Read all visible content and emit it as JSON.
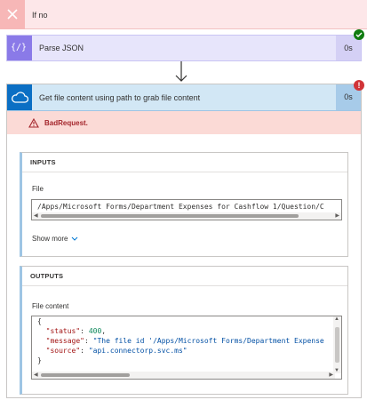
{
  "if_no": {
    "label": "If no"
  },
  "parse_json": {
    "title": "Parse JSON",
    "duration": "0s"
  },
  "get_file": {
    "title": "Get file content using path to grab file content",
    "duration": "0s",
    "error_badge": "!"
  },
  "error": {
    "message": "BadRequest."
  },
  "inputs": {
    "header": "INPUTS",
    "file_label": "File",
    "file_value": "/Apps/Microsoft Forms/Department Expenses for Cashflow 1/Question/C",
    "show_more": "Show more"
  },
  "outputs": {
    "header": "OUTPUTS",
    "content_label": "File content",
    "lines": {
      "open": "{",
      "status_key": "\"status\"",
      "status_val": "400",
      "message_key": "\"message\"",
      "message_val": "\"The file id '/Apps/Microsoft Forms/Department Expense",
      "source_key": "\"source\"",
      "source_val": "\"api.connectorp.svc.ms\"",
      "close": "}"
    }
  },
  "colors": {
    "error_red": "#d13438",
    "success_green": "#107c10",
    "parse_purple": "#8a7ae8",
    "onedrive_blue": "#0b6fc4"
  },
  "icons": [
    "close-icon",
    "json-braces-icon",
    "check-icon",
    "down-arrow-icon",
    "cloud-icon",
    "warning-icon",
    "chevron-down-icon"
  ]
}
